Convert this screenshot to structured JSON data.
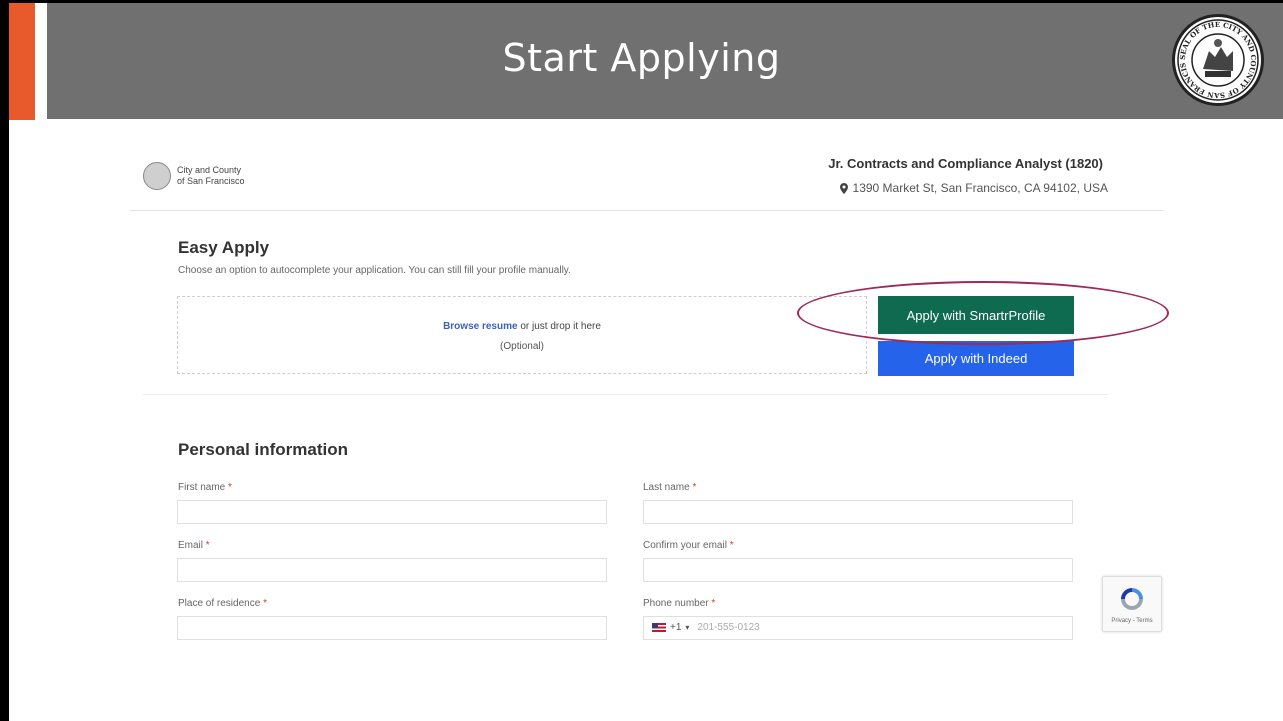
{
  "slide": {
    "title": "Start Applying",
    "seal_text": "SEAL OF THE CITY AND COUNTY OF SAN FRANCISCO"
  },
  "job_page": {
    "logo": {
      "line1": "City and County",
      "line2": "of San Francisco"
    },
    "job_title": "Jr. Contracts and Compliance Analyst (1820)",
    "location": "1390 Market St, San Francisco, CA 94102, USA"
  },
  "easy_apply": {
    "title": "Easy Apply",
    "description": "Choose an option to autocomplete your application. You can still fill your profile manually.",
    "browse_link": "Browse resume",
    "drop_text": " or just drop it here",
    "optional": "(Optional)",
    "btn_smartr": "Apply with SmartrProfile",
    "btn_indeed": "Apply with Indeed"
  },
  "personal": {
    "title": "Personal information",
    "first_name": "First name",
    "last_name": "Last name",
    "email": "Email",
    "confirm_email": "Confirm your email",
    "residence": "Place of residence",
    "phone": "Phone number",
    "req": "*",
    "phone_code": "+1",
    "phone_caret": "▾",
    "phone_placeholder": "201-555-0123"
  },
  "recaptcha": {
    "text": "Privacy - Terms"
  },
  "colors": {
    "header": "#707070",
    "accent": "#e8592b",
    "smartr": "#0f6b4f",
    "indeed": "#2563eb",
    "highlight": "#9c2a5c"
  }
}
